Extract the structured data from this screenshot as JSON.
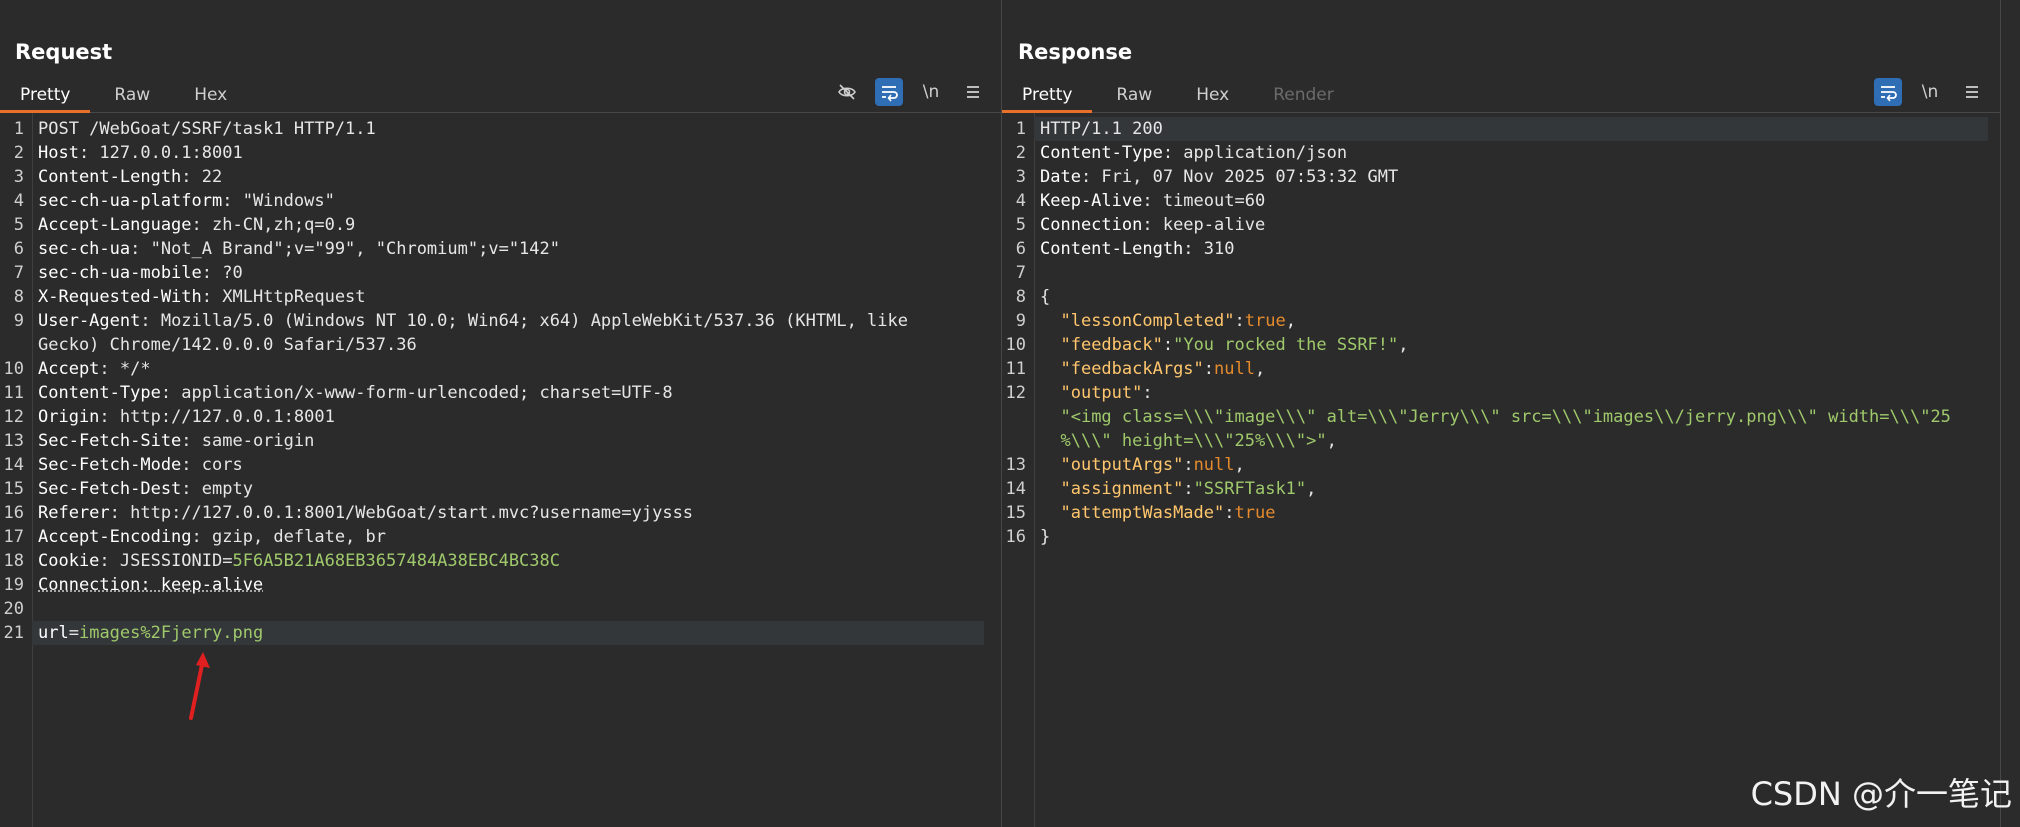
{
  "layout_buttons": [
    "split-horizontal",
    "split-vertical",
    "single"
  ],
  "request": {
    "title": "Request",
    "tabs": [
      {
        "label": "Pretty",
        "active": true
      },
      {
        "label": "Raw"
      },
      {
        "label": "Hex"
      }
    ],
    "tools": [
      "eye-off-icon",
      "wrap-icon",
      "\\n",
      "menu-icon"
    ],
    "lines": [
      {
        "n": "1",
        "parts": [
          [
            "v",
            "POST /WebGoat/SSRF/task1 HTTP/1.1"
          ]
        ]
      },
      {
        "n": "2",
        "parts": [
          [
            "k",
            "Host"
          ],
          [
            "v",
            ": 127.0.0.1:8001"
          ]
        ]
      },
      {
        "n": "3",
        "parts": [
          [
            "k",
            "Content-Length"
          ],
          [
            "v",
            ": 22"
          ]
        ]
      },
      {
        "n": "4",
        "parts": [
          [
            "k",
            "sec-ch-ua-platform"
          ],
          [
            "v",
            ": \"Windows\""
          ]
        ]
      },
      {
        "n": "5",
        "parts": [
          [
            "k",
            "Accept-Language"
          ],
          [
            "v",
            ": zh-CN,zh;q=0.9"
          ]
        ]
      },
      {
        "n": "6",
        "parts": [
          [
            "k",
            "sec-ch-ua"
          ],
          [
            "v",
            ": \"Not_A Brand\";v=\"99\", \"Chromium\";v=\"142\""
          ]
        ]
      },
      {
        "n": "7",
        "parts": [
          [
            "k",
            "sec-ch-ua-mobile"
          ],
          [
            "v",
            ": ?0"
          ]
        ]
      },
      {
        "n": "8",
        "parts": [
          [
            "k",
            "X-Requested-With"
          ],
          [
            "v",
            ": XMLHttpRequest"
          ]
        ]
      },
      {
        "n": "9",
        "parts": [
          [
            "k",
            "User-Agent"
          ],
          [
            "v",
            ": Mozilla/5.0 (Windows NT 10.0; Win64; x64) AppleWebKit/537.36 (KHTML, like"
          ]
        ]
      },
      {
        "n": "",
        "parts": [
          [
            "v",
            "Gecko) Chrome/142.0.0.0 Safari/537.36"
          ]
        ]
      },
      {
        "n": "10",
        "parts": [
          [
            "k",
            "Accept"
          ],
          [
            "v",
            ": */*"
          ]
        ]
      },
      {
        "n": "11",
        "parts": [
          [
            "k",
            "Content-Type"
          ],
          [
            "v",
            ": application/x-www-form-urlencoded; charset=UTF-8"
          ]
        ]
      },
      {
        "n": "12",
        "parts": [
          [
            "k",
            "Origin"
          ],
          [
            "v",
            ": http://127.0.0.1:8001"
          ]
        ]
      },
      {
        "n": "13",
        "parts": [
          [
            "k",
            "Sec-Fetch-Site"
          ],
          [
            "v",
            ": same-origin"
          ]
        ]
      },
      {
        "n": "14",
        "parts": [
          [
            "k",
            "Sec-Fetch-Mode"
          ],
          [
            "v",
            ": cors"
          ]
        ]
      },
      {
        "n": "15",
        "parts": [
          [
            "k",
            "Sec-Fetch-Dest"
          ],
          [
            "v",
            ": empty"
          ]
        ]
      },
      {
        "n": "16",
        "parts": [
          [
            "k",
            "Referer"
          ],
          [
            "v",
            ": http://127.0.0.1:8001/WebGoat/start.mvc?username=yjysss"
          ]
        ]
      },
      {
        "n": "17",
        "parts": [
          [
            "k",
            "Accept-Encoding"
          ],
          [
            "v",
            ": gzip, deflate, br"
          ]
        ]
      },
      {
        "n": "18",
        "parts": [
          [
            "k",
            "Cookie"
          ],
          [
            "v",
            ": JSESSIONID="
          ],
          [
            "g",
            "5F6A5B21A68EB3657484A38EBC4BC38C"
          ]
        ]
      },
      {
        "n": "19",
        "parts": [
          [
            "ku",
            "Connection: keep-alive"
          ]
        ]
      },
      {
        "n": "20",
        "parts": []
      },
      {
        "n": "21",
        "parts": [
          [
            "k",
            "url"
          ],
          [
            "v",
            "="
          ],
          [
            "g",
            "images%2Fjerry.png"
          ]
        ],
        "highlight": true
      }
    ]
  },
  "response": {
    "title": "Response",
    "tabs": [
      {
        "label": "Pretty",
        "active": true
      },
      {
        "label": "Raw"
      },
      {
        "label": "Hex"
      },
      {
        "label": "Render",
        "disabled": true
      }
    ],
    "tools": [
      "wrap-icon",
      "\\n",
      "menu-icon"
    ],
    "lines": [
      {
        "n": "1",
        "parts": [
          [
            "v",
            "HTTP/1.1 200"
          ]
        ],
        "highlight": true
      },
      {
        "n": "2",
        "parts": [
          [
            "k",
            "Content-Type"
          ],
          [
            "v",
            ": application/json"
          ]
        ]
      },
      {
        "n": "3",
        "parts": [
          [
            "k",
            "Date"
          ],
          [
            "v",
            ": Fri, 07 Nov 2025 07:53:32 GMT"
          ]
        ]
      },
      {
        "n": "4",
        "parts": [
          [
            "k",
            "Keep-Alive"
          ],
          [
            "v",
            ": timeout=60"
          ]
        ]
      },
      {
        "n": "5",
        "parts": [
          [
            "k",
            "Connection"
          ],
          [
            "v",
            ": keep-alive"
          ]
        ]
      },
      {
        "n": "6",
        "parts": [
          [
            "k",
            "Content-Length"
          ],
          [
            "v",
            ": 310"
          ]
        ]
      },
      {
        "n": "7",
        "parts": []
      },
      {
        "n": "8",
        "parts": [
          [
            "v",
            "{"
          ]
        ]
      },
      {
        "n": "9",
        "parts": [
          [
            "v",
            "  "
          ],
          [
            "y",
            "\"lessonCompleted\""
          ],
          [
            "v",
            ":"
          ],
          [
            "o",
            "true"
          ],
          [
            "v",
            ","
          ]
        ]
      },
      {
        "n": "10",
        "parts": [
          [
            "v",
            "  "
          ],
          [
            "y",
            "\"feedback\""
          ],
          [
            "v",
            ":"
          ],
          [
            "g",
            "\"You rocked the SSRF!\""
          ],
          [
            "v",
            ","
          ]
        ]
      },
      {
        "n": "11",
        "parts": [
          [
            "v",
            "  "
          ],
          [
            "y",
            "\"feedbackArgs\""
          ],
          [
            "v",
            ":"
          ],
          [
            "o",
            "null"
          ],
          [
            "v",
            ","
          ]
        ]
      },
      {
        "n": "12",
        "parts": [
          [
            "v",
            "  "
          ],
          [
            "y",
            "\"output\""
          ],
          [
            "v",
            ":"
          ]
        ]
      },
      {
        "n": "",
        "parts": [
          [
            "v",
            "  "
          ],
          [
            "g",
            "\"<img class=\\\\\\\"image\\\\\\\" alt=\\\\\\\"Jerry\\\\\\\" src=\\\\\\\"images\\\\/jerry.png\\\\\\\" width=\\\\\\\"25"
          ]
        ]
      },
      {
        "n": "",
        "parts": [
          [
            "v",
            "  "
          ],
          [
            "g",
            "%\\\\\\\" height=\\\\\\\"25%\\\\\\\">\""
          ],
          [
            "v",
            ","
          ]
        ]
      },
      {
        "n": "13",
        "parts": [
          [
            "v",
            "  "
          ],
          [
            "y",
            "\"outputArgs\""
          ],
          [
            "v",
            ":"
          ],
          [
            "o",
            "null"
          ],
          [
            "v",
            ","
          ]
        ]
      },
      {
        "n": "14",
        "parts": [
          [
            "v",
            "  "
          ],
          [
            "y",
            "\"assignment\""
          ],
          [
            "v",
            ":"
          ],
          [
            "g",
            "\"SSRFTask1\""
          ],
          [
            "v",
            ","
          ]
        ]
      },
      {
        "n": "15",
        "parts": [
          [
            "v",
            "  "
          ],
          [
            "y",
            "\"attemptWasMade\""
          ],
          [
            "v",
            ":"
          ],
          [
            "o",
            "true"
          ]
        ]
      },
      {
        "n": "16",
        "parts": [
          [
            "v",
            "}"
          ]
        ]
      }
    ]
  },
  "watermark": "CSDN @介一笔记",
  "colors": {
    "accent": "#e8702a",
    "active_button": "#2f6db5",
    "string": "#9fc96b",
    "keyword": "#e58b2d",
    "json_key": "#ffc66d",
    "annotation_arrow": "#e02020"
  }
}
